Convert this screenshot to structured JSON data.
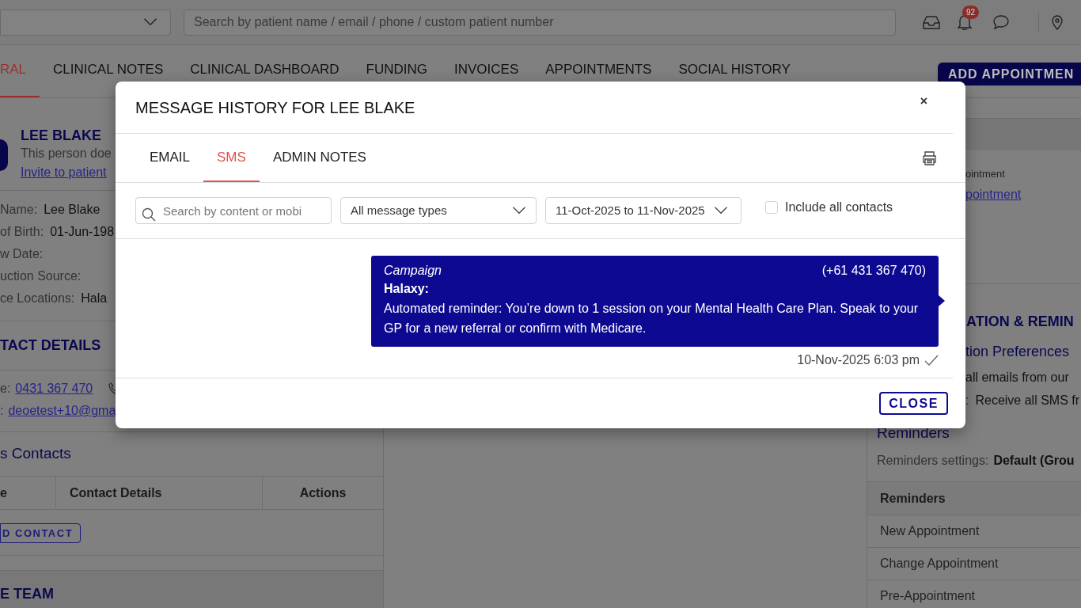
{
  "top_bar": {
    "search_placeholder": "Search by patient name / email / phone / custom patient number",
    "notification_count": "92"
  },
  "tabs": [
    {
      "label": "RAL",
      "selected": true
    },
    {
      "label": "CLINICAL NOTES",
      "selected": false
    },
    {
      "label": "CLINICAL DASHBOARD",
      "selected": false
    },
    {
      "label": "FUNDING",
      "selected": false
    },
    {
      "label": "INVOICES",
      "selected": false
    },
    {
      "label": "APPOINTMENTS",
      "selected": false
    },
    {
      "label": "SOCIAL HISTORY",
      "selected": false
    }
  ],
  "add_appointment_button": "ADD APPOINTMEN",
  "patient_panel": {
    "name": "LEE BLAKE",
    "note": "This person doe",
    "invite_link": "Invite to patient",
    "fields": [
      {
        "label": "Name:",
        "value": "Lee Blake"
      },
      {
        "label": "of Birth:",
        "value": "01-Jun-198"
      },
      {
        "label": "w Date:"
      },
      {
        "label": "uction Source:"
      },
      {
        "label": "ce Locations:",
        "value": "Hala"
      }
    ]
  },
  "contact_details": {
    "title": "TACT DETAILS",
    "phone_label": "e:",
    "phone": "0431 367 470",
    "email_label": ":",
    "email": "deoetest+10@gma"
  },
  "contacts": {
    "title": "s Contacts",
    "columns": [
      "e",
      "Contact Details",
      "Actions"
    ],
    "add_button": "D CONTACT"
  },
  "care_team": {
    "title": "E TEAM"
  },
  "right_panel": {
    "appointment_label": "ointment",
    "appointment_link": "pointment",
    "section_title": "ATION & REMIN",
    "preferences_title": "tion Preferences",
    "email_pref": "all emails from our",
    "sms_pref_label": ":",
    "sms_pref": "Receive all SMS fr",
    "reminders_title": "Reminders",
    "settings_label": "Reminders settings:",
    "settings_value": "Default (Grou",
    "reminders_header": "Reminders",
    "reminders": [
      "New Appointment",
      "Change Appointment",
      "Pre-Appointment"
    ]
  },
  "modal": {
    "title": "MESSAGE HISTORY FOR LEE BLAKE",
    "close": "×",
    "tabs": [
      {
        "label": "EMAIL",
        "selected": false
      },
      {
        "label": "SMS",
        "selected": true
      },
      {
        "label": "ADMIN NOTES",
        "selected": false
      }
    ],
    "search_placeholder": "Search by content or mobi",
    "message_type": "All message types",
    "date_range": "11-Oct-2025 to 11-Nov-2025",
    "include_all_contacts": {
      "label": "Include all contacts",
      "checked": false
    },
    "messages": [
      {
        "type": "Campaign",
        "phone": "(+61 431 367 470)",
        "sender": "Halaxy:",
        "body": "Automated reminder: You’re down to 1 session on your Mental Health Care Plan. Speak to your GP for a new referral or confirm with Medicare.",
        "time": "10-Nov-2025 6:03 pm",
        "delivered": true
      }
    ],
    "close_button": "CLOSE"
  }
}
